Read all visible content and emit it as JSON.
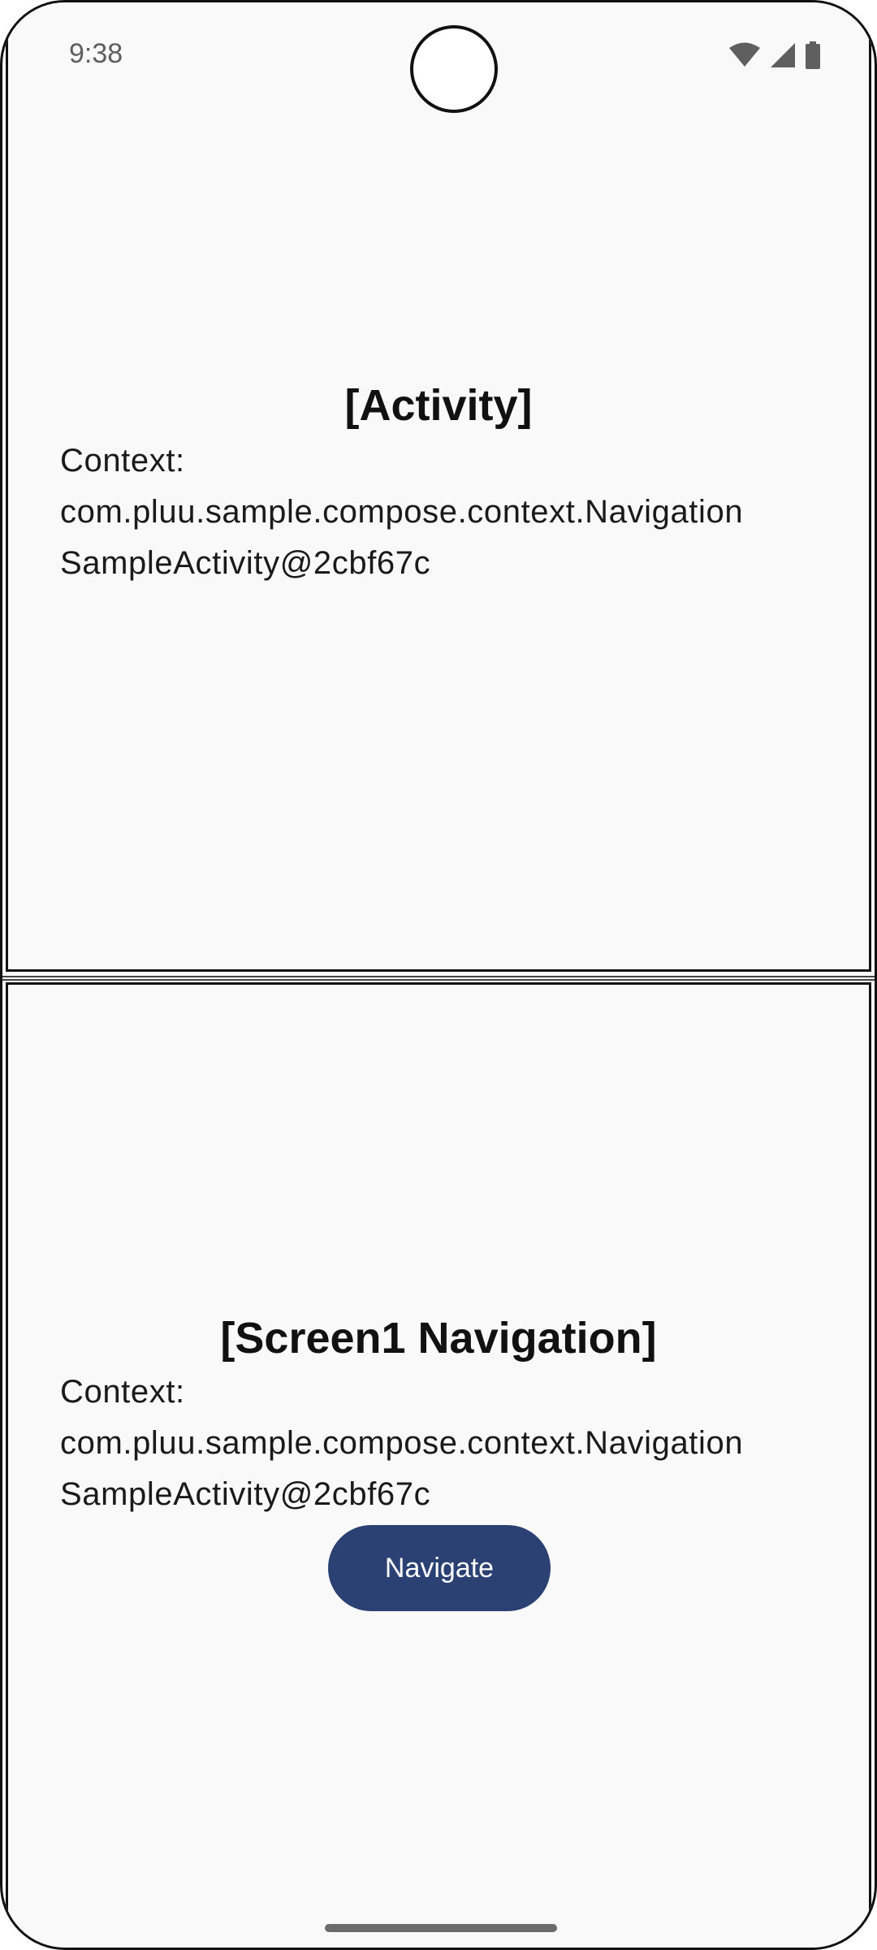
{
  "status_bar": {
    "time": "9:38",
    "icons": [
      "wifi-icon",
      "cellular-signal-icon",
      "battery-icon"
    ]
  },
  "activity_panel": {
    "title": "[Activity]",
    "context_lines": [
      "Context:",
      "com.pluu.sample.compose.context.Navigation",
      "SampleActivity@2cbf67c"
    ]
  },
  "screen_panel": {
    "title": "[Screen1 Navigation]",
    "context_lines": [
      "Context:",
      "com.pluu.sample.compose.context.Navigation",
      "SampleActivity@2cbf67c"
    ],
    "button_label": "Navigate"
  },
  "colors": {
    "background": "#f9f9f9",
    "button": "#2b4173",
    "text": "#111111"
  }
}
